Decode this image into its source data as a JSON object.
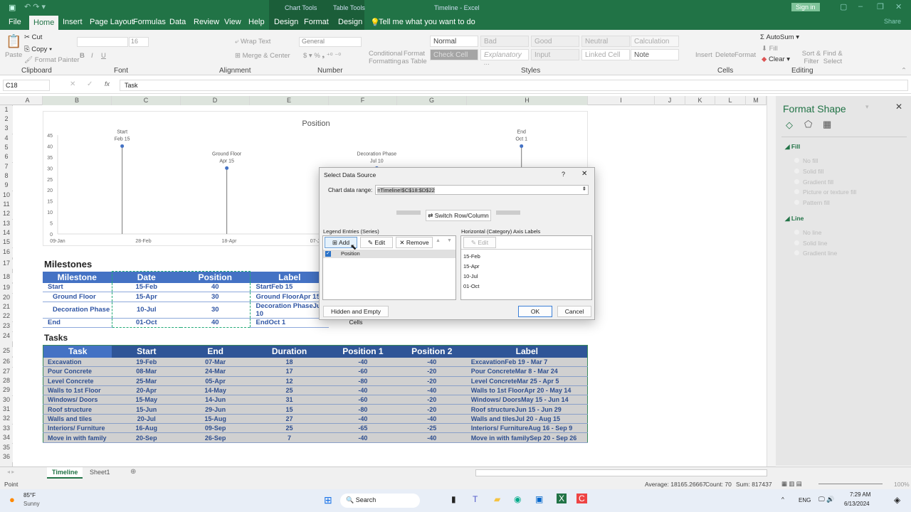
{
  "title_bar": {
    "context_chart": "Chart Tools",
    "context_table": "Table Tools",
    "title": "Timeline - Excel",
    "sign_in": "Sign in",
    "share": "Share"
  },
  "tabs": [
    "File",
    "Home",
    "Insert",
    "Page Layout",
    "Formulas",
    "Data",
    "Review",
    "View",
    "Help",
    "Design",
    "Format",
    "Design"
  ],
  "tell_me": "Tell me what you want to do",
  "ribbon": {
    "clipboard": {
      "paste": "Paste",
      "cut": "Cut",
      "copy": "Copy",
      "format_painter": "Format Painter",
      "label": "Clipboard"
    },
    "font": {
      "size": "16",
      "label": "Font"
    },
    "alignment": {
      "wrap": "Wrap Text",
      "merge": "Merge & Center",
      "label": "Alignment"
    },
    "number": {
      "format": "General",
      "label": "Number"
    },
    "styles": {
      "cond": "Conditional Formatting",
      "table": "Format as Table",
      "items": [
        "Normal",
        "Bad",
        "Good",
        "Neutral",
        "Calculation",
        "Check Cell",
        "Explanatory ...",
        "Input",
        "Linked Cell",
        "Note"
      ],
      "label": "Styles"
    },
    "cells": {
      "insert": "Insert",
      "delete": "Delete",
      "format": "Format",
      "label": "Cells"
    },
    "editing": {
      "autosum": "AutoSum",
      "fill": "Fill",
      "clear": "Clear",
      "sort": "Sort & Filter",
      "find": "Find & Select",
      "label": "Editing"
    }
  },
  "formula_bar": {
    "name_box": "C18",
    "fx": "fx",
    "value": "Task"
  },
  "columns": [
    "A",
    "B",
    "C",
    "D",
    "E",
    "F",
    "G",
    "H",
    "I",
    "J",
    "K",
    "L",
    "M"
  ],
  "rows": [
    "1",
    "2",
    "3",
    "4",
    "5",
    "6",
    "7",
    "8",
    "9",
    "10",
    "11",
    "12",
    "13",
    "14",
    "15",
    "16",
    "17",
    "18",
    "19",
    "20",
    "21",
    "22",
    "23",
    "24",
    "25",
    "26",
    "27",
    "28",
    "29",
    "30",
    "31",
    "32",
    "33",
    "34",
    "35",
    "36"
  ],
  "chart_data": {
    "type": "scatter",
    "title": "Position",
    "ylim": [
      0,
      45
    ],
    "yticks": [
      "0",
      "5",
      "10",
      "15",
      "20",
      "25",
      "30",
      "35",
      "40",
      "45"
    ],
    "xticks": [
      "09-Jan",
      "28-Feb",
      "18-Apr",
      "07-J"
    ],
    "points": [
      {
        "date": "2024-02-15",
        "y": 40,
        "label1": "Start",
        "label2": "Feb 15"
      },
      {
        "date": "2024-04-15",
        "y": 30,
        "label1": "Ground Floor",
        "label2": "Apr 15"
      },
      {
        "date": "2024-07-10",
        "y": 30,
        "label1": "Decoration Phase",
        "label2": "Jul 10"
      },
      {
        "date": "2024-10-01",
        "y": 40,
        "label1": "End",
        "label2": "Oct 1"
      }
    ],
    "color": "#4472c4"
  },
  "milestones": {
    "title": "Milestones",
    "headers": [
      "Milestone",
      "Date",
      "Position",
      "Label"
    ],
    "rows": [
      [
        "Start",
        "15-Feb",
        "40",
        "StartFeb 15"
      ],
      [
        "Ground Floor",
        "15-Apr",
        "30",
        "Ground FloorApr 15"
      ],
      [
        "Decoration Phase",
        "10-Jul",
        "30",
        "Decoration PhaseJul 10"
      ],
      [
        "End",
        "01-Oct",
        "40",
        "EndOct 1"
      ]
    ]
  },
  "tasks": {
    "title": "Tasks",
    "headers": [
      "Task",
      "Start",
      "End",
      "Duration",
      "Position 1",
      "Position 2",
      "Label"
    ],
    "rows": [
      [
        "Excavation",
        "19-Feb",
        "07-Mar",
        "18",
        "-40",
        "-40",
        "ExcavationFeb 19 - Mar 7"
      ],
      [
        "Pour Concrete",
        "08-Mar",
        "24-Mar",
        "17",
        "-60",
        "-20",
        "Pour ConcreteMar 8 - Mar 24"
      ],
      [
        "Level Concrete",
        "25-Mar",
        "05-Apr",
        "12",
        "-80",
        "-20",
        "Level ConcreteMar 25 - Apr 5"
      ],
      [
        "Walls to 1st Floor",
        "20-Apr",
        "14-May",
        "25",
        "-40",
        "-40",
        "Walls to 1st FloorApr 20 - May 14"
      ],
      [
        "Windows/ Doors",
        "15-May",
        "14-Jun",
        "31",
        "-60",
        "-20",
        "Windows/ DoorsMay 15 - Jun 14"
      ],
      [
        "Roof structure",
        "15-Jun",
        "29-Jun",
        "15",
        "-80",
        "-20",
        "Roof structureJun 15 - Jun 29"
      ],
      [
        "Walls and tiles",
        "20-Jul",
        "15-Aug",
        "27",
        "-40",
        "-40",
        "Walls and tilesJul 20 - Aug 15"
      ],
      [
        "Interiors/ Furniture",
        "16-Aug",
        "09-Sep",
        "25",
        "-65",
        "-25",
        "Interiors/ FurnitureAug 16 - Sep 9"
      ],
      [
        "Move in with family",
        "20-Sep",
        "26-Sep",
        "7",
        "-40",
        "-40",
        "Move in with familySep 20 - Sep 26"
      ]
    ]
  },
  "format_pane": {
    "title": "Format Shape",
    "fill": "Fill",
    "fill_options": [
      "No fill",
      "Solid fill",
      "Gradient fill",
      "Picture or texture fill",
      "Pattern fill"
    ],
    "line": "Line",
    "line_options": [
      "No line",
      "Solid line",
      "Gradient line"
    ]
  },
  "dialog": {
    "title": "Select Data Source",
    "help": "?",
    "range_label": "Chart data range:",
    "range_value": "=Timeline!$C$18:$D$22",
    "switch": "Switch Row/Column",
    "legend_label": "Legend Entries (Series)",
    "add": "Add",
    "edit": "Edit",
    "remove": "Remove",
    "series": [
      "Position"
    ],
    "axis_label": "Horizontal (Category) Axis Labels",
    "axis_edit": "Edit",
    "axis_items": [
      "15-Feb",
      "15-Apr",
      "10-Jul",
      "01-Oct"
    ],
    "hidden": "Hidden and Empty Cells",
    "ok": "OK",
    "cancel": "Cancel"
  },
  "sheets": [
    "Timeline",
    "Sheet1"
  ],
  "status": {
    "mode": "Point",
    "average": "Average: 18165.26667",
    "count": "Count: 70",
    "sum": "Sum: 817437",
    "zoom": "100%"
  },
  "taskbar": {
    "temp": "85°F",
    "weather": "Sunny",
    "search": "Search",
    "lang": "ENG",
    "time": "7:29 AM",
    "date": "6/13/2024"
  }
}
